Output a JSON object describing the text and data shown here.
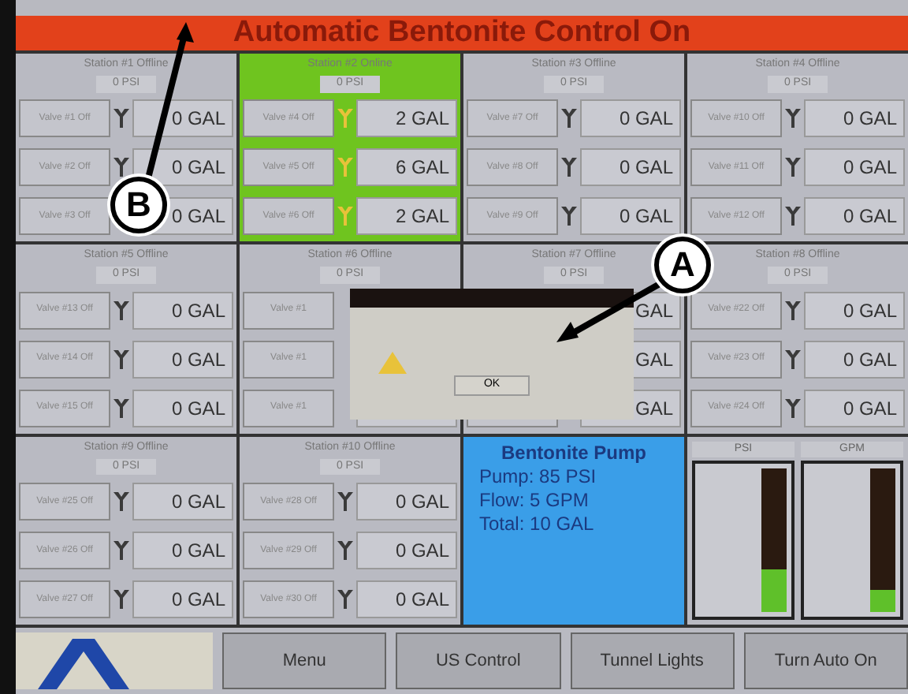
{
  "title": "Automatic Bentonite Control On",
  "stations": [
    {
      "title": "Station #1 Offline",
      "reading": "0 PSI",
      "online": false,
      "valves": [
        {
          "label": "Valve #1 Off",
          "amount": "0 GAL",
          "active": false
        },
        {
          "label": "Valve #2 Off",
          "amount": "0 GAL",
          "active": false
        },
        {
          "label": "Valve #3 Off",
          "amount": "0 GAL"
        }
      ]
    },
    {
      "title": "Station #2 Online",
      "reading": "0 PSI",
      "online": true,
      "valves": [
        {
          "label": "Valve #4 Off",
          "amount": "2 GAL",
          "active": true
        },
        {
          "label": "Valve #5 Off",
          "amount": "6 GAL",
          "active": true
        },
        {
          "label": "Valve #6 Off",
          "amount": "2 GAL",
          "active": true
        }
      ]
    },
    {
      "title": "Station #3 Offline",
      "reading": "0 PSI",
      "online": false,
      "valves": [
        {
          "label": "Valve #7 Off",
          "amount": "0 GAL",
          "active": false
        },
        {
          "label": "Valve #8 Off",
          "amount": "0 GAL",
          "active": false
        },
        {
          "label": "Valve #9 Off",
          "amount": "0 GAL",
          "active": false
        }
      ]
    },
    {
      "title": "Station #4 Offline",
      "reading": "0 PSI",
      "online": false,
      "valves": [
        {
          "label": "Valve #10 Off",
          "amount": "0 GAL",
          "active": false
        },
        {
          "label": "Valve #11 Off",
          "amount": "0 GAL",
          "active": false
        },
        {
          "label": "Valve #12 Off",
          "amount": "0 GAL",
          "active": false
        }
      ]
    },
    {
      "title": "Station #5 Offline",
      "reading": "0 PSI",
      "online": false,
      "valves": [
        {
          "label": "Valve #13 Off",
          "amount": "0 GAL",
          "active": false
        },
        {
          "label": "Valve #14 Off",
          "amount": "0 GAL",
          "active": false
        },
        {
          "label": "Valve #15 Off",
          "amount": "0 GAL",
          "active": false
        }
      ]
    },
    {
      "title": "Station #6 Offline",
      "reading": "0 PSI",
      "online": false,
      "valves": [
        {
          "label": "Valve #1"
        },
        {
          "label": "Valve #1"
        },
        {
          "label": "Valve #1"
        }
      ]
    },
    {
      "title": "Station #7 Offline",
      "reading": "0 PSI",
      "online": false,
      "valves": [
        {
          "amount": "GAL"
        },
        {
          "amount": "GAL"
        },
        {
          "amount": "GAL"
        }
      ]
    },
    {
      "title": "Station #8 Offline",
      "reading": "0 PSI",
      "online": false,
      "valves": [
        {
          "label": "Valve #22 Off",
          "amount": "0 GAL",
          "active": false
        },
        {
          "label": "Valve #23 Off",
          "amount": "0 GAL",
          "active": false
        },
        {
          "label": "Valve #24 Off",
          "amount": "0 GAL",
          "active": false
        }
      ]
    },
    {
      "title": "Station #9 Offline",
      "reading": "0 PSI",
      "online": false,
      "valves": [
        {
          "label": "Valve #25 Off",
          "amount": "0 GAL",
          "active": false
        },
        {
          "label": "Valve #26 Off",
          "amount": "0 GAL",
          "active": false
        },
        {
          "label": "Valve #27 Off",
          "amount": "0 GAL",
          "active": false
        }
      ]
    },
    {
      "title": "Station #10 Offline",
      "reading": "0 PSI",
      "online": false,
      "valves": [
        {
          "label": "Valve #28 Off",
          "amount": "0 GAL",
          "active": false
        },
        {
          "label": "Valve #29 Off",
          "amount": "0 GAL",
          "active": false
        },
        {
          "label": "Valve #30 Off",
          "amount": "0 GAL",
          "active": false
        }
      ]
    }
  ],
  "pump": {
    "title": "Bentonite Pump",
    "lines": [
      "Pump: 85 PSI",
      "Flow: 5 GPM",
      "Total: 10 GAL"
    ]
  },
  "gauges": [
    {
      "label": "PSI",
      "level": 0.3
    },
    {
      "label": "GPM",
      "level": 0.15
    }
  ],
  "dialog": {
    "button": "OK"
  },
  "buttons": [
    "Menu",
    "US Control",
    "Tunnel Lights",
    "Turn Auto On"
  ],
  "callouts": [
    {
      "letter": "A"
    },
    {
      "letter": "B"
    }
  ]
}
